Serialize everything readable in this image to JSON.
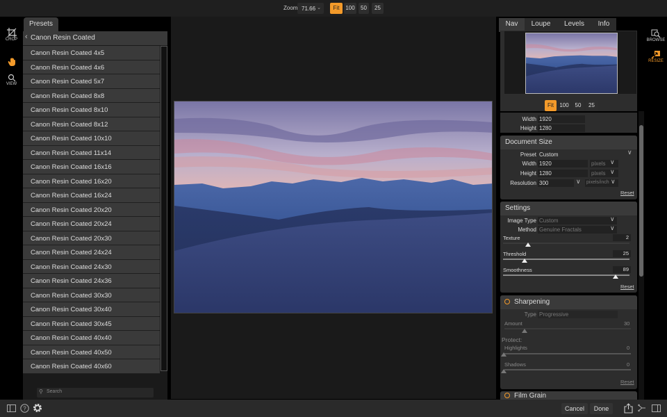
{
  "topbar": {
    "zoom_label": "Zoom",
    "zoom_value": "71.66",
    "zoom_buttons": [
      "Fit",
      "100",
      "50",
      "25"
    ],
    "active_zoom": "Fit"
  },
  "left_tools": [
    {
      "label": "CROP",
      "icon": "crop-icon"
    },
    {
      "label": "",
      "icon": "hand-icon",
      "color": "#f39a2a"
    },
    {
      "label": "VIEW",
      "icon": "magnifier-icon"
    }
  ],
  "presets": {
    "tab_label": "Presets",
    "header": "Canon Resin Coated",
    "items": [
      "Canon Resin Coated 4x5",
      "Canon Resin Coated 4x6",
      "Canon Resin Coated 5x7",
      "Canon Resin Coated 8x8",
      "Canon Resin Coated 8x10",
      "Canon Resin Coated 8x12",
      "Canon Resin Coated 10x10",
      "Canon Resin Coated 11x14",
      "Canon Resin Coated 16x16",
      "Canon Resin Coated 16x20",
      "Canon Resin Coated 16x24",
      "Canon Resin Coated 20x20",
      "Canon Resin Coated 20x24",
      "Canon Resin Coated 20x30",
      "Canon Resin Coated 24x24",
      "Canon Resin Coated 24x30",
      "Canon Resin Coated 24x36",
      "Canon Resin Coated 30x30",
      "Canon Resin Coated 30x40",
      "Canon Resin Coated 30x45",
      "Canon Resin Coated 40x40",
      "Canon Resin Coated 40x50",
      "Canon Resin Coated 40x60"
    ],
    "search_placeholder": "Search"
  },
  "right_tabs": [
    "Nav",
    "Loupe",
    "Levels",
    "Info"
  ],
  "active_right_tab": "Nav",
  "nav": {
    "zoom_buttons": [
      "Fit",
      "100",
      "50",
      "25"
    ],
    "active_zoom": "Fit"
  },
  "pixel_dims": {
    "width_label": "Width",
    "width": "1920",
    "height_label": "Height",
    "height": "1280"
  },
  "document_size": {
    "title": "Document Size",
    "preset_label": "Preset",
    "preset": "Custom",
    "width_label": "Width",
    "width": "1920",
    "width_unit": "pixels",
    "height_label": "Height",
    "height": "1280",
    "height_unit": "pixels",
    "resolution_label": "Resolution",
    "resolution": "300",
    "resolution_unit": "pixels/inch",
    "reset": "Reset"
  },
  "settings": {
    "title": "Settings",
    "image_type_label": "Image Type",
    "image_type": "Custom",
    "method_label": "Method",
    "method": "Genuine Fractals",
    "sliders": [
      {
        "label": "Texture",
        "value": "2",
        "fraction": 0.2
      },
      {
        "label": "Threshold",
        "value": "25",
        "fraction": 0.17
      },
      {
        "label": "Smoothness",
        "value": "89",
        "fraction": 0.89
      }
    ],
    "reset": "Reset"
  },
  "sharpening": {
    "title": "Sharpening",
    "type_label": "Type",
    "type": "Progressive",
    "amount_label": "Amount",
    "amount": "30",
    "amount_fraction": 0.16,
    "protect_label": "Protect:",
    "highlights_label": "Highlights",
    "highlights": "0",
    "shadows_label": "Shadows",
    "shadows": "0",
    "reset": "Reset"
  },
  "film_grain": {
    "title": "Film Grain"
  },
  "far_right": [
    {
      "label": "BROWSE",
      "icon": "browse-icon"
    },
    {
      "label": "RESIZE",
      "icon": "resize-icon",
      "color": "#f39a2a"
    }
  ],
  "bottom": {
    "cancel": "Cancel",
    "done": "Done"
  },
  "colors": {
    "accent": "#f39a2a"
  }
}
